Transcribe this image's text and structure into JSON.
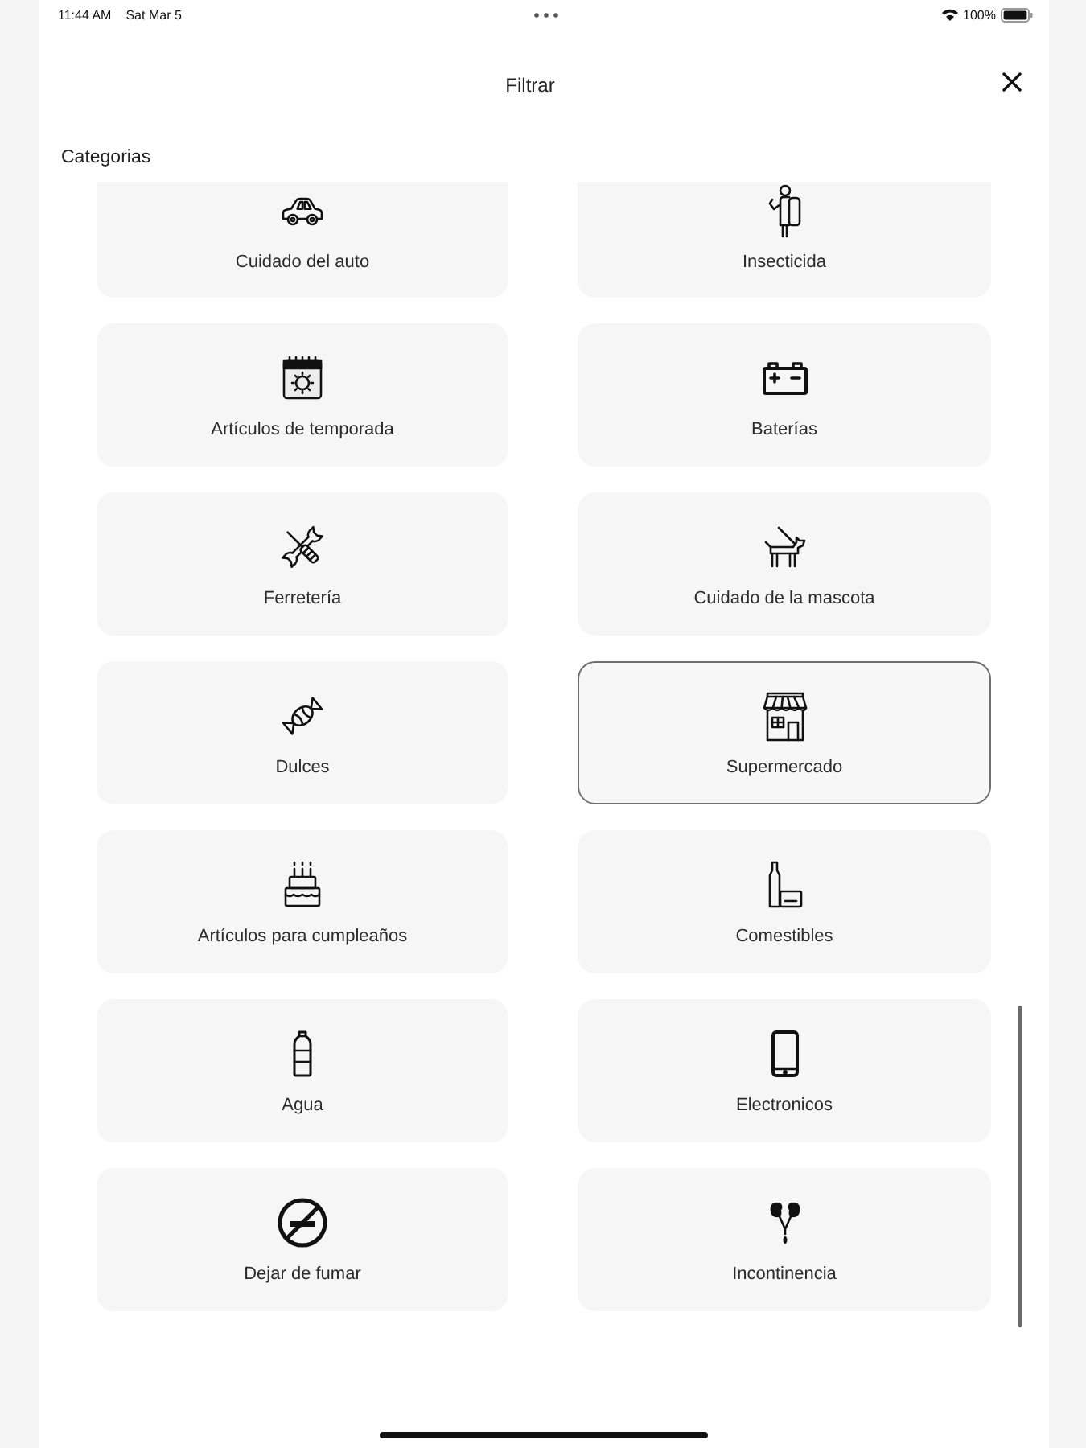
{
  "status_bar": {
    "time": "11:44 AM",
    "date": "Sat Mar 5",
    "battery": "100%"
  },
  "header": {
    "title": "Filtrar"
  },
  "section": {
    "title": "Categorias"
  },
  "categories": [
    {
      "label": "Cuidado del auto",
      "selected": false
    },
    {
      "label": "Insecticida",
      "selected": false
    },
    {
      "label": "Artículos de temporada",
      "selected": false
    },
    {
      "label": "Baterías",
      "selected": false
    },
    {
      "label": "Ferretería",
      "selected": false
    },
    {
      "label": "Cuidado de la mascota",
      "selected": false
    },
    {
      "label": "Dulces",
      "selected": false
    },
    {
      "label": "Supermercado",
      "selected": true
    },
    {
      "label": "Artículos para cumpleaños",
      "selected": false
    },
    {
      "label": "Comestibles",
      "selected": false
    },
    {
      "label": "Agua",
      "selected": false
    },
    {
      "label": "Electronicos",
      "selected": false
    },
    {
      "label": "Dejar de fumar",
      "selected": false
    },
    {
      "label": "Incontinencia",
      "selected": false
    }
  ]
}
